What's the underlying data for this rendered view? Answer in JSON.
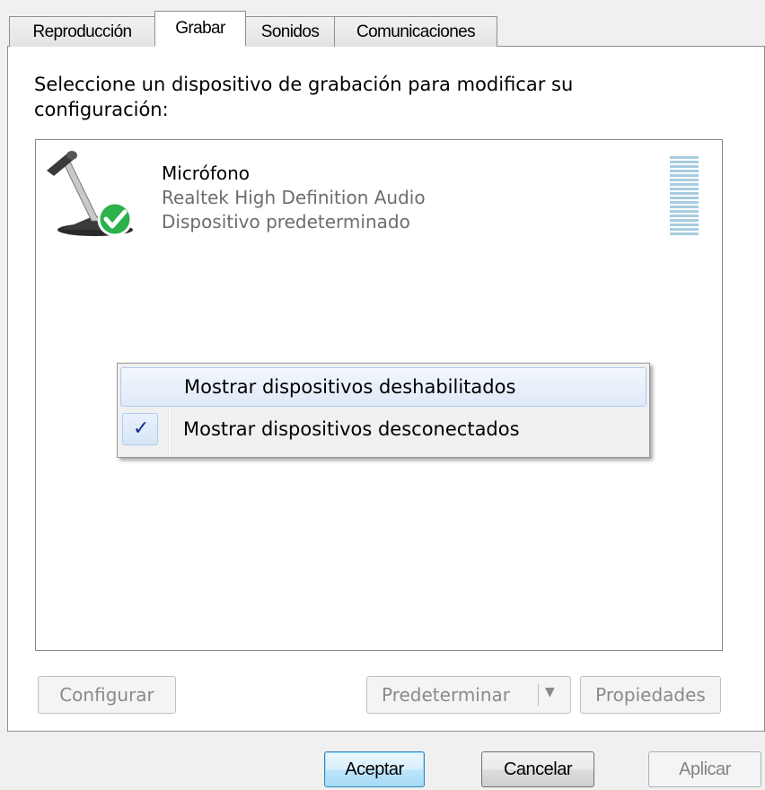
{
  "tabs": [
    {
      "label": "Reproducción",
      "active": false
    },
    {
      "label": "Grabar",
      "active": true
    },
    {
      "label": "Sonidos",
      "active": false
    },
    {
      "label": "Comunicaciones",
      "active": false
    }
  ],
  "instructions": "Seleccione un dispositivo de grabación para modificar su configuración:",
  "device": {
    "icon": "microphone-icon",
    "name": "Micrófono",
    "driver": "Realtek High Definition Audio",
    "status": "Dispositivo predeterminado",
    "default_badge_color": "#2bb24c"
  },
  "context_menu": {
    "items": [
      {
        "label": "Mostrar dispositivos deshabilitados",
        "checked": false
      },
      {
        "label": "Mostrar dispositivos desconectados",
        "checked": true
      }
    ],
    "check_glyph": "✓"
  },
  "panel_buttons": {
    "configure": "Configurar",
    "set_default": "Predeterminar",
    "set_default_arrow": "▼",
    "properties": "Propiedades"
  },
  "dialog_buttons": {
    "ok": "Aceptar",
    "cancel": "Cancelar",
    "apply": "Aplicar"
  },
  "colors": {
    "level_meter": "#a7cddf",
    "accent_button": "#3c7fb1",
    "menu_highlight": "#aeccf0"
  }
}
